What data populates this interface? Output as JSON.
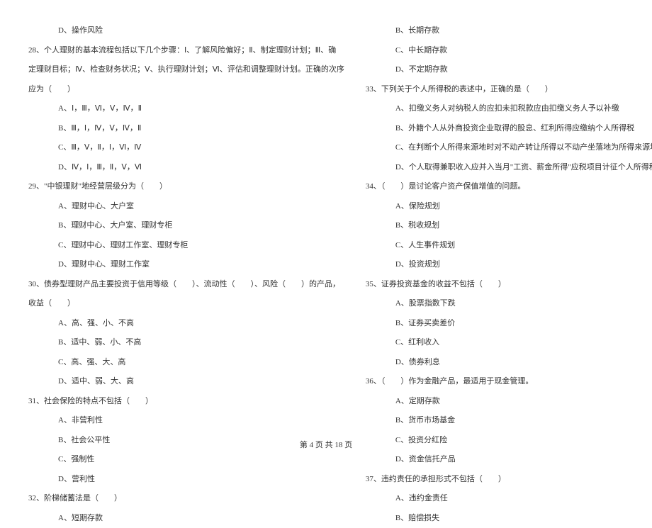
{
  "left": {
    "l0": "D、操作风险",
    "l1": "28、个人理财的基本流程包括以下几个步骤：Ⅰ、了解风险偏好；Ⅱ、制定理财计划；Ⅲ、确",
    "l2": "定理财目标；Ⅳ、检查财务状况；Ⅴ、执行理财计划；Ⅵ、评估和调整理财计划。正确的次序",
    "l3": "应为（　　）",
    "l4": "A、Ⅰ，Ⅲ，Ⅵ，Ⅴ，Ⅳ，Ⅱ",
    "l5": "B、Ⅲ，Ⅰ，Ⅳ，Ⅴ，Ⅳ，Ⅱ",
    "l6": "C、Ⅲ，Ⅴ，Ⅱ，Ⅰ，Ⅵ，Ⅳ",
    "l7": "D、Ⅳ，Ⅰ，Ⅲ，Ⅱ，Ⅴ，Ⅵ",
    "l8": "29、\"中银理财\"地经营层级分为（　　）",
    "l9": "A、理财中心、大户室",
    "l10": "B、理财中心、大户室、理财专柜",
    "l11": "C、理财中心、理财工作室、理财专柜",
    "l12": "D、理财中心、理财工作室",
    "l13": "30、债券型理财产品主要投资于信用等级（　　）、流动性（　　）、风险（　　）的产品，",
    "l14": "收益（　　）",
    "l15": "A、高、强、小、不高",
    "l16": "B、适中、弱、小、不高",
    "l17": "C、高、强、大、高",
    "l18": "D、适中、弱、大、高",
    "l19": "31、社会保险的特点不包括（　　）",
    "l20": "A、非营利性",
    "l21": "B、社会公平性",
    "l22": "C、强制性",
    "l23": "D、营利性",
    "l24": "32、阶梯储蓄法是（　　）",
    "l25": "A、短期存款"
  },
  "right": {
    "r0": "B、长期存款",
    "r1": "C、中长期存款",
    "r2": "D、不定期存款",
    "r3": "33、下列关于个人所得税的表述中，正确的是（　　）",
    "r4": "A、扣缴义务人对纳税人的应扣未扣税款应由扣缴义务人予以补缴",
    "r5": "B、外籍个人从外商投资企业取得的股息、红利所得应缴纳个人所得税",
    "r6": "C、在判断个人所得来源地时对不动产转让所得以不动产坐落地为所得来源地",
    "r7": "D、个人取得兼职收入应并入当月\"工资、薪金所得\"应税项目计征个人所得税",
    "r8": "34、（　　）是讨论客户资产保值增值的问题。",
    "r9": "A、保险规划",
    "r10": "B、税收规划",
    "r11": "C、人生事件规划",
    "r12": "D、投资规划",
    "r13": "35、证券投资基金的收益不包括（　　）",
    "r14": "A、股票指数下跌",
    "r15": "B、证券买卖差价",
    "r16": "C、红利收入",
    "r17": "D、债券利息",
    "r18": "36、（　　）作为金融产品，最适用于现金管理。",
    "r19": "A、定期存款",
    "r20": "B、货币市场基金",
    "r21": "C、投资分红险",
    "r22": "D、资金信托产品",
    "r23": "37、违约责任的承担形式不包括（　　）",
    "r24": "A、违约金责任",
    "r25": "B、赔偿损失"
  },
  "footer": "第 4 页 共 18 页"
}
